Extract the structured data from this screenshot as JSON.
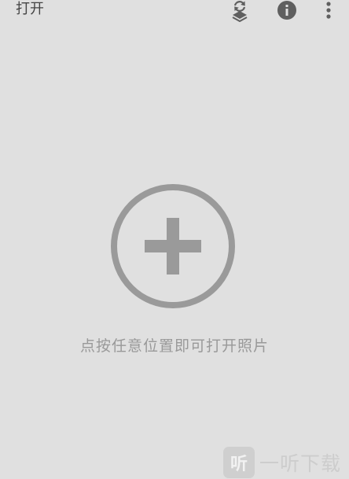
{
  "app_bar": {
    "title": "打开",
    "actions": [
      {
        "icon": "layers-undo-icon"
      },
      {
        "icon": "info-icon"
      },
      {
        "icon": "more-vert-icon"
      }
    ]
  },
  "main": {
    "add_icon": "add-circle-icon",
    "hint": "点按任意位置即可打开照片"
  },
  "watermark": {
    "badge": "听",
    "text": "一听下载"
  },
  "colors": {
    "background": "#e0e0e0",
    "icon": "#5f5f5f",
    "add_icon": "#9a9a9a",
    "hint_text": "#999999"
  }
}
